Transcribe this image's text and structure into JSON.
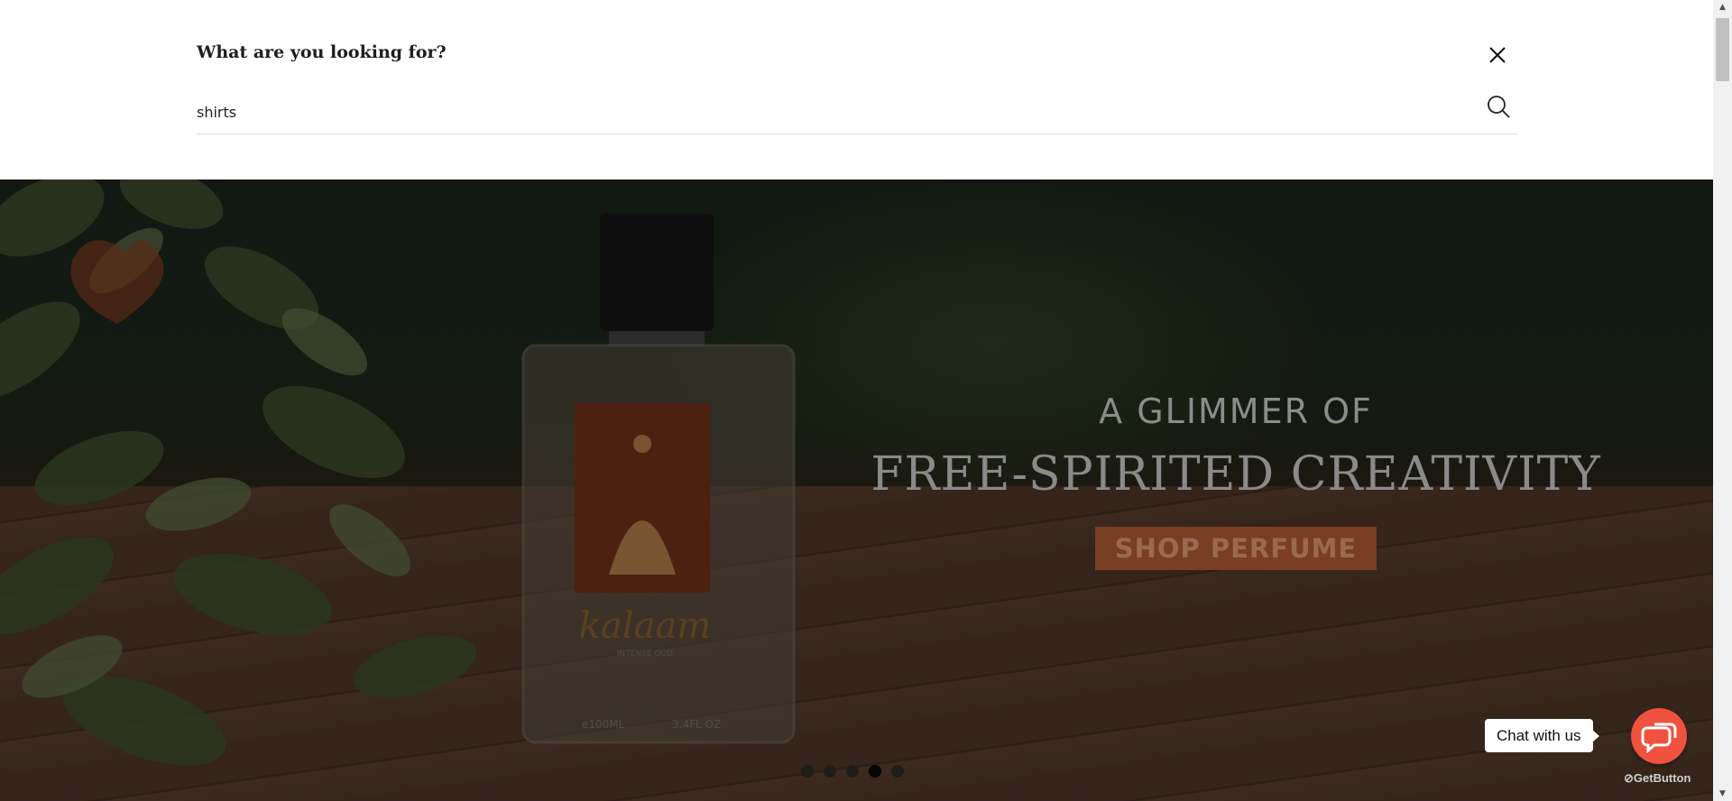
{
  "search": {
    "title": "What are you looking for?",
    "query": "shirts",
    "close_icon": "close-icon",
    "search_icon": "search-icon"
  },
  "hero": {
    "subhead": "A GLIMMER OF",
    "headline": "FREE-SPIRITED CREATIVITY",
    "cta_label": "SHOP PERFUME",
    "product_image": "kalaam-intense-oud-perfume-bottle",
    "slides_total": 5,
    "active_slide": 4
  },
  "chat": {
    "label": "Chat with us",
    "icon": "chat-bubbles-icon",
    "brand": "GetButton",
    "accent": "#f0523f"
  }
}
